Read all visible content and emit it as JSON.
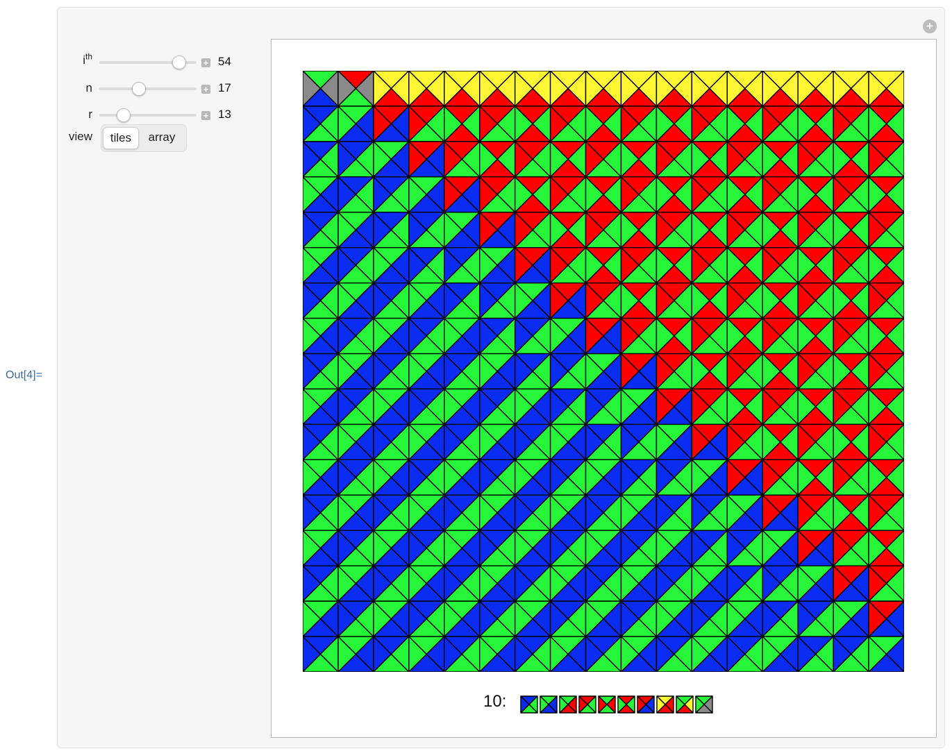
{
  "output_label": "Out[4]=",
  "controls": {
    "ith": {
      "label": "i",
      "label_sup": "th",
      "value": "54"
    },
    "n": {
      "label": "n",
      "value": "17"
    },
    "r": {
      "label": "r",
      "value": "13"
    },
    "view": {
      "label": "view",
      "options": [
        "tiles",
        "array"
      ],
      "selected": "tiles"
    }
  },
  "icons": {
    "corner": "plus-circle-icon",
    "stepper": "plus-square-icon"
  },
  "colors": {
    "blue": "#0a2cf0",
    "green": "#27f539",
    "red": "#ff0000",
    "yellow": "#fff734",
    "gray": "#8a8a8a",
    "line": "#000000",
    "accent_label": "#3b6aa0"
  },
  "legend": {
    "label": "10:",
    "tiles": [
      [
        "B",
        "G",
        "G",
        "B"
      ],
      [
        "G",
        "B",
        "B",
        "G"
      ],
      [
        "G",
        "R",
        "R",
        "G"
      ],
      [
        "R",
        "G",
        "G",
        "R"
      ],
      [
        "G",
        "R",
        "G",
        "R"
      ],
      [
        "R",
        "G",
        "R",
        "G"
      ],
      [
        "R",
        "B",
        "B",
        "R"
      ],
      [
        "Y",
        "R",
        "R",
        "Y"
      ],
      [
        "G",
        "Y",
        "R",
        "G"
      ],
      [
        "G",
        "X",
        "X",
        "G"
      ]
    ]
  },
  "tiling": {
    "columns": 17,
    "rows": 17,
    "palette": {
      "B": "blue",
      "G": "green",
      "R": "red",
      "Y": "yellow",
      "X": "gray"
    }
  }
}
